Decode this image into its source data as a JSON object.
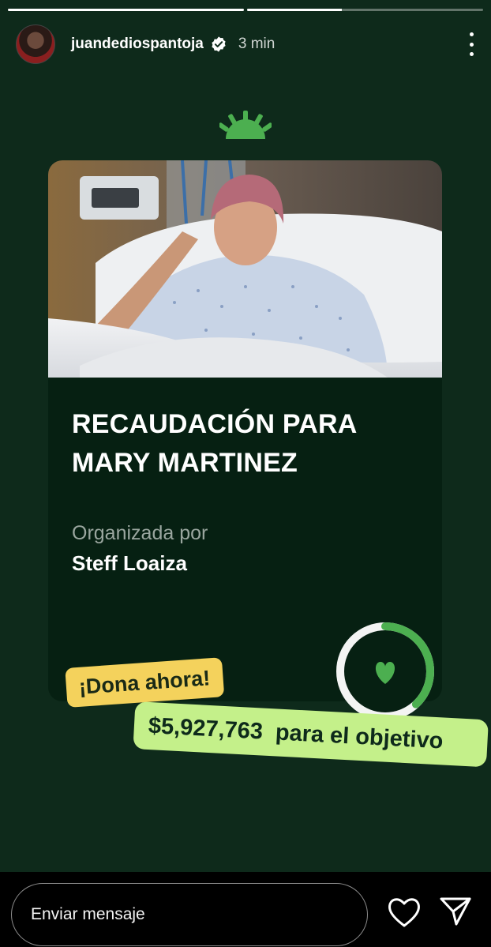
{
  "story": {
    "progress": [
      {
        "fraction": 1.0
      },
      {
        "fraction": 0.4
      }
    ],
    "header": {
      "username": "juandediospantoja",
      "time": "3 min",
      "verified": true,
      "avatar_icon": "profile-avatar",
      "more_icon": "more-vertical-icon"
    },
    "background_color": "#0e2a1b"
  },
  "card": {
    "logo_icon": "gofundme-logo-icon",
    "photo_description_icon": "hospital-photo",
    "title": "RECAUDACIÓN PARA MARY MARTINEZ",
    "organizer_label": "Organizada por",
    "organizer_name": "Steff Loaiza",
    "progress_fraction": 0.38,
    "ring_icon": "heart-icon"
  },
  "stickers": {
    "donate": "¡Dona ahora!",
    "amount": "$5,927,763",
    "amount_suffix": "para el objetivo"
  },
  "bottom_bar": {
    "message_placeholder": "Enviar mensaje",
    "like_icon": "heart-outline-icon",
    "send_icon": "send-icon"
  },
  "colors": {
    "accent_green": "#4caf50",
    "donate_yellow": "#f4d25c",
    "goal_lime": "#c4f08a"
  }
}
